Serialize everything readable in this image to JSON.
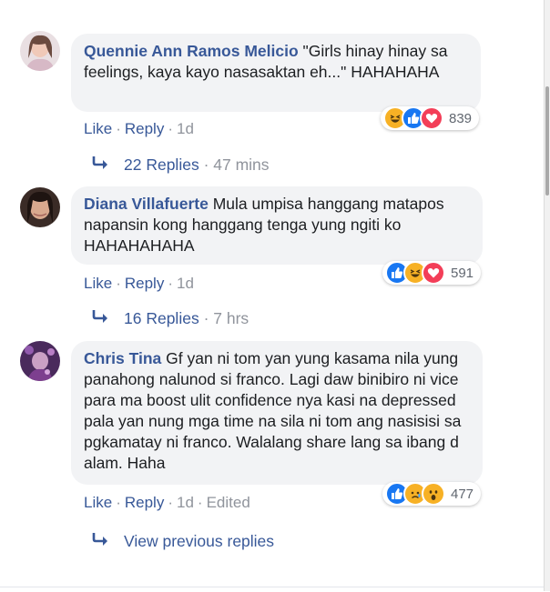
{
  "comments": [
    {
      "author": "Quennie Ann Ramos Melicio",
      "text": "\"Girls hinay hinay sa feelings, kaya kayo nasasaktan eh...\" HAHAHAHA",
      "like": "Like",
      "reply": "Reply",
      "time": "1d",
      "reaction_count": "839",
      "reactions": [
        "haha-icon",
        "like-icon",
        "love-icon"
      ],
      "replies_label": "22 Replies",
      "replies_time": "47 mins"
    },
    {
      "author": "Diana Villafuerte",
      "text": "Mula umpisa hanggang matapos napansin kong hanggang tenga yung ngiti ko HAHAHAHAHA",
      "like": "Like",
      "reply": "Reply",
      "time": "1d",
      "reaction_count": "591",
      "reactions": [
        "like-icon",
        "haha-icon",
        "love-icon"
      ],
      "replies_label": "16 Replies",
      "replies_time": "7 hrs"
    },
    {
      "author": "Chris Tina",
      "text": "Gf yan ni tom yan yung kasama nila yung panahong nalunod si franco. Lagi daw binibiro ni vice para ma boost ulit confidence nya kasi na depressed pala yan nung mga time na sila ni tom ang nasisisi sa pgkamatay ni franco. Walalang share lang sa ibang d alam. Haha",
      "like": "Like",
      "reply": "Reply",
      "time": "1d",
      "edited": "Edited",
      "reaction_count": "477",
      "reactions": [
        "like-icon",
        "sad-icon",
        "wow-icon"
      ],
      "view_previous": "View previous replies"
    }
  ],
  "colors": {
    "link": "#385898",
    "bubble": "#f2f3f5",
    "meta": "#90949c",
    "like": "#1877f2",
    "love": "#f33e58",
    "haha": "#f7b125"
  }
}
